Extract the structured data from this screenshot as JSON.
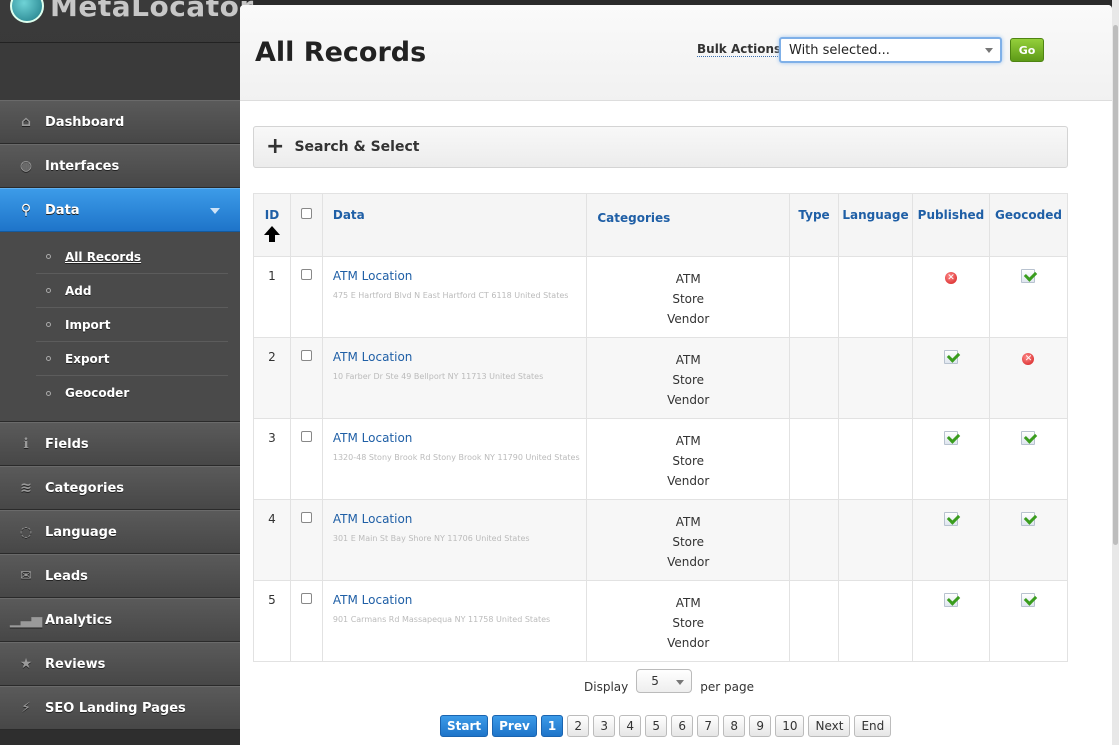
{
  "app": {
    "logo_text": "MetaLocator"
  },
  "sidebar": {
    "items": [
      {
        "label": "Dashboard",
        "icon": "home-icon"
      },
      {
        "label": "Interfaces",
        "icon": "globe-icon"
      },
      {
        "label": "Data",
        "icon": "map-pin-icon",
        "active": true
      },
      {
        "label": "Fields",
        "icon": "info-icon"
      },
      {
        "label": "Categories",
        "icon": "layers-icon"
      },
      {
        "label": "Language",
        "icon": "speech-bubble-icon"
      },
      {
        "label": "Leads",
        "icon": "envelope-icon"
      },
      {
        "label": "Analytics",
        "icon": "bar-chart-icon"
      },
      {
        "label": "Reviews",
        "icon": "star-icon"
      },
      {
        "label": "SEO Landing Pages",
        "icon": "lightning-icon"
      }
    ],
    "data_subitems": [
      "All Records",
      "Add",
      "Import",
      "Export",
      "Geocoder"
    ]
  },
  "header": {
    "title": "All Records",
    "bulk_label": "Bulk Actions:",
    "bulk_selected": "With selected...",
    "go_label": "Go"
  },
  "search": {
    "label": "Search & Select"
  },
  "table": {
    "columns": [
      "ID",
      "Data",
      "Categories",
      "Type",
      "Language",
      "Published",
      "Geocoded"
    ],
    "rows": [
      {
        "id": "1",
        "name": "ATM Location",
        "address": "475 E Hartford Blvd N East Hartford CT 6118 United States",
        "categories": [
          "ATM",
          "Store",
          "Vendor"
        ],
        "published": false,
        "geocoded": true
      },
      {
        "id": "2",
        "name": "ATM Location",
        "address": "10 Farber Dr Ste 49 Bellport NY 11713 United States",
        "categories": [
          "ATM",
          "Store",
          "Vendor"
        ],
        "published": true,
        "geocoded": false
      },
      {
        "id": "3",
        "name": "ATM Location",
        "address": "1320-48 Stony Brook Rd Stony Brook NY 11790 United States",
        "categories": [
          "ATM",
          "Store",
          "Vendor"
        ],
        "published": true,
        "geocoded": true
      },
      {
        "id": "4",
        "name": "ATM Location",
        "address": "301 E Main St Bay Shore NY 11706 United States",
        "categories": [
          "ATM",
          "Store",
          "Vendor"
        ],
        "published": true,
        "geocoded": true
      },
      {
        "id": "5",
        "name": "ATM Location",
        "address": "901 Carmans Rd Massapequa NY 11758 United States",
        "categories": [
          "ATM",
          "Store",
          "Vendor"
        ],
        "published": true,
        "geocoded": true
      }
    ]
  },
  "pagination": {
    "display_label": "Display",
    "per_page_value": "5",
    "per_page_label": "per page",
    "start": "Start",
    "prev": "Prev",
    "pages": [
      "1",
      "2",
      "3",
      "4",
      "5",
      "6",
      "7",
      "8",
      "9",
      "10"
    ],
    "current_page": "1",
    "next": "Next",
    "end": "End"
  }
}
